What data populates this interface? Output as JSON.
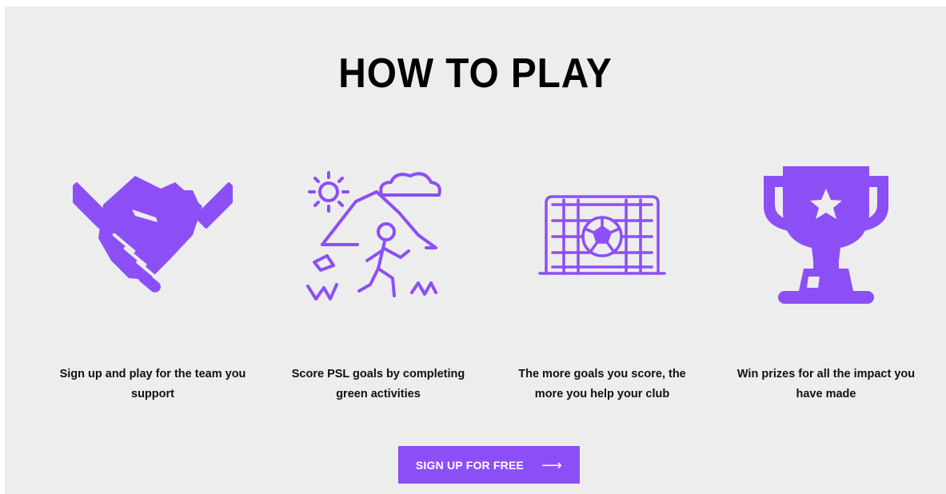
{
  "section": {
    "title": "HOW TO PLAY"
  },
  "colors": {
    "accent": "#8c4ff5",
    "background": "#ededed",
    "text": "#111111"
  },
  "steps": [
    {
      "icon": "handshake-icon",
      "text": "Sign up and play for the team you support"
    },
    {
      "icon": "hiking-nature-icon",
      "text": "Score PSL goals by completing green activities"
    },
    {
      "icon": "soccer-goal-icon",
      "text": "The more goals you score, the more you help your club"
    },
    {
      "icon": "trophy-icon",
      "text": "Win prizes for all the impact you have made"
    }
  ],
  "cta": {
    "label": "SIGN UP FOR FREE",
    "arrow": "⟶"
  }
}
